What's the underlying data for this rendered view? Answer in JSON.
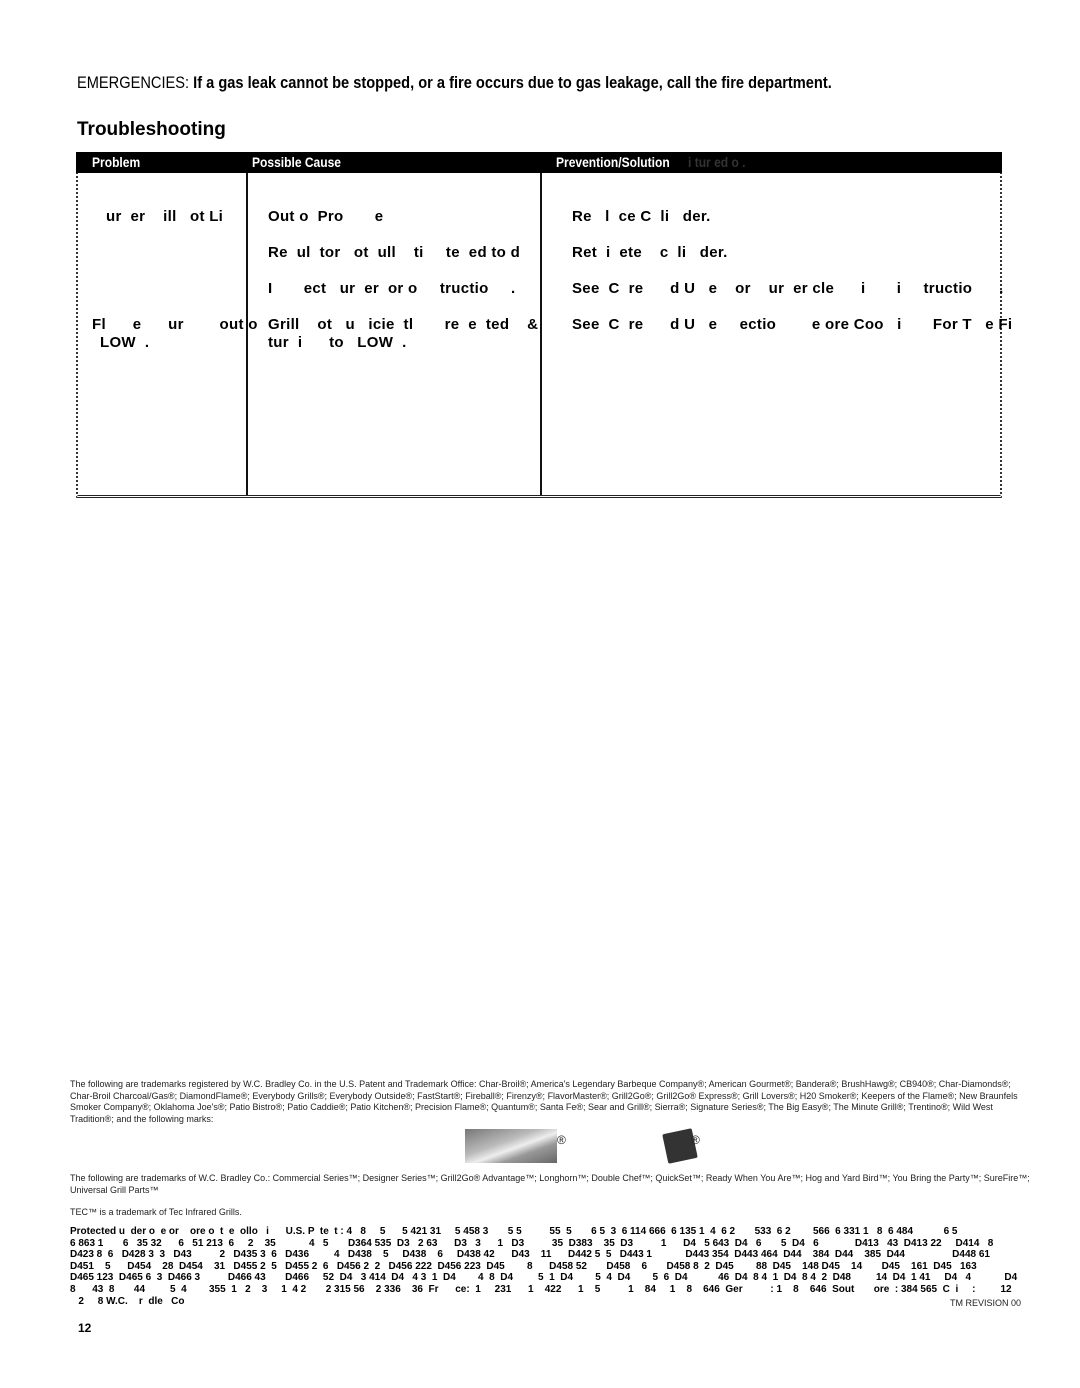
{
  "emergency": {
    "label": "EMERGENCIES: ",
    "message": "If a gas leak cannot be stopped, or a fire occurs due to gas leakage, call the fire department."
  },
  "section_title": "Troubleshooting",
  "table": {
    "headers": [
      "Problem",
      "Possible Cause",
      "Prevention/Solution"
    ],
    "header_ghost_text": "i  tur  ed o .",
    "rows": [
      {
        "problem": "ur  er    ill   ot Li",
        "cause": "Out o  Pro       e",
        "solution": "Re   l  ce C  li   der."
      },
      {
        "problem": "",
        "cause": "Re  ul  tor   ot  ull    ti     te  ed to d",
        "solution": "Ret  i  ete    c  li   der."
      },
      {
        "problem": "",
        "cause": "I       ect   ur  er  or o     tructio     .",
        "solution": "See  C  re      d U   e    or    ur  er cle      i       i     tructio      ."
      },
      {
        "problem": "Fl      e      ur        out o",
        "problem_line2": "LOW  .",
        "cause": "Grill    ot   u   icie  tl       re  e  ted    &",
        "cause_line2": "tur  i      to   LOW  .",
        "solution": "See  C  re      d U   e     ectio        e ore Coo   i       For T   e Fi"
      }
    ]
  },
  "trademarks": {
    "registered": "The following are trademarks registered by W.C. Bradley Co. in the U.S. Patent and Trademark Office: Char-Broil®; America's Legendary Barbeque Company®; American Gourmet®; Bandera®; BrushHawg®; CB940®; Char-Diamonds®; Char-Broil Charcoal/Gas®; DiamondFlame®; Everybody Grills®; Everybody Outside®; FastStart®; Fireball®; Firenzy®; FlavorMaster®; Grill2Go®; Grill2Go® Express®; Grill Lovers®; H20 Smoker®; Keepers of the Flame®; New Braunfels Smoker Company®; Oklahoma Joe's®; Patio Bistro®; Patio Caddie®; Patio Kitchen®; Precision Flame®; Quantum®; Santa Fe®; Sear and Grill®; Sierra®; Signature Series®; The Big Easy®; The Minute Grill®; Trentino®; Wild West Tradition®; and the following marks:",
    "registered_symbol": "®",
    "unregistered": "The following are trademarks of W.C. Bradley Co.: Commercial Series™; Designer Series™; Grill2Go® Advantage™; Longhorn™; Double Chef™; QuickSet™; Ready When You Are™; Hog and Yard Bird™; You Bring the Party™; SureFire™; Universal Grill Parts™",
    "tec": "TEC™ is a trademark of Tec Infrared Grills."
  },
  "patents": {
    "lines": [
      "Protected u  der o  e or    ore o  t  e  ollo   i      U.S. P  te  t : 4   8     5      5 421 31     5 458 3       5 5          55  5       6 5  3  6 114 666  6 135 1  4  6 2       533  6 2        566  6 331 1   8  6 484           6 5",
      "6 863 1       6   35 32      6   51 213  6     2    35            4   5       D364 535  D3   2 63      D3   3      1   D3          35  D383    35  D3          1      D4   5 643  D4   6       5  D4   6             D413   43  D413 22     D414   8",
      "D423 8  6   D428 3  3   D43          2   D435 3  6   D436         4   D438    5     D438    6     D438 42      D43    11      D442 5  5   D443 1            D443 354  D443 464  D44    384  D44    385  D44                 D448 61",
      "D451    5      D454    28  D454    31   D455 2  5   D455 2  6   D456 2  2   D456 222  D456 223  D45        8      D458 52       D458    6       D458 8  2  D45        88  D45    148 D45    14       D45    161  D45   163",
      "D465 123  D465 6  3  D466 3          D466 43       D466     52  D4   3 414  D4   4 3  1  D4        4  8  D4         5  1  D4        5  4  D4        5  6  D4           46  D4  8 4  1  D4  8 4  2  D48         14  D4  1 41     D4   4            D4",
      "8      43  8       44         5  4        355  1   2    3     1  4 2       2 315 56    2 336    36  Fr      ce:  1     231      1    422      1    5          1    84     1    8    646  Ger          : 1    8    646  Sout       ore  : 384 565  C  i     :         12",
      "   2     8 W.C.    r  dle   Co"
    ],
    "revision": "TM REVISION 00"
  },
  "page_number": "12"
}
